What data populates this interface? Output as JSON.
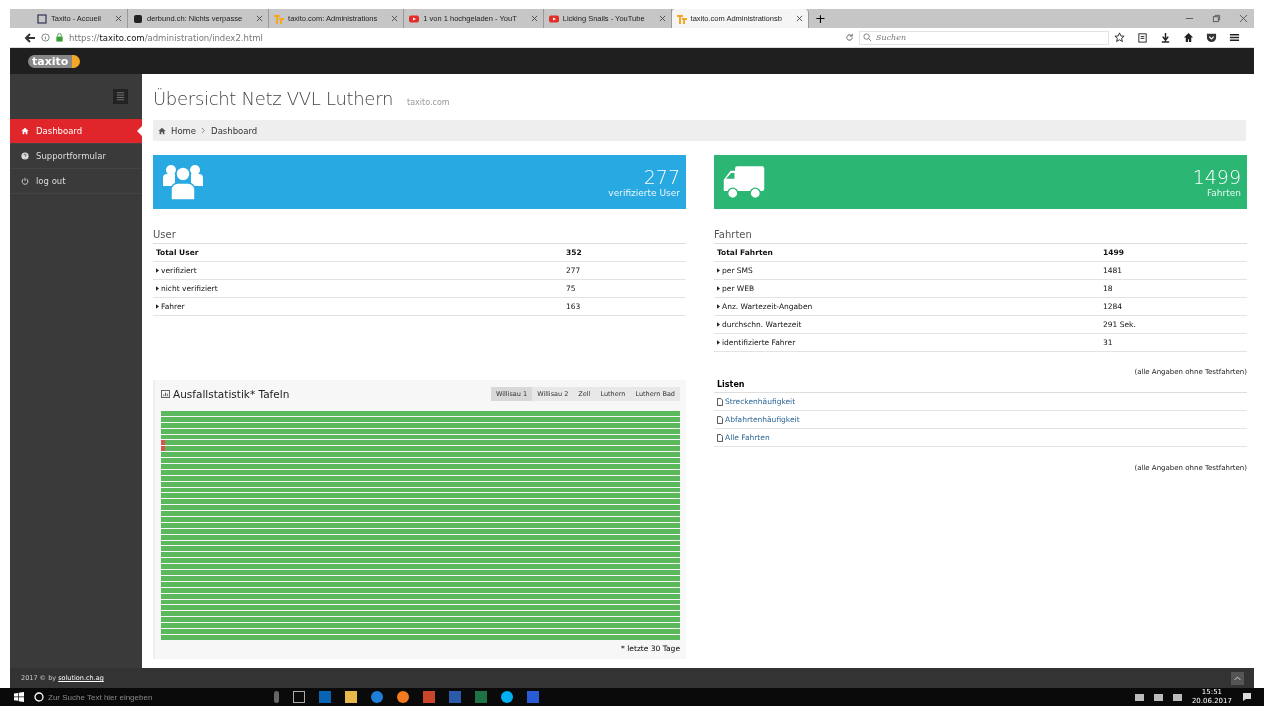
{
  "browser": {
    "tabs": [
      {
        "title": "Taxito - Accueil",
        "selected": false
      },
      {
        "title": "derbund.ch: Nichts verpasse",
        "selected": false
      },
      {
        "title": "taxito.com: Administrations",
        "selected": false
      },
      {
        "title": "1 von 1 hochgeladen - YouT",
        "selected": false
      },
      {
        "title": "Licking Snails - YouTube",
        "selected": false
      },
      {
        "title": "taxito.com Administrationsb",
        "selected": true
      }
    ],
    "new_tab": "+",
    "url_scheme": "https://",
    "url_host": "taxito.com",
    "url_path": "/administration/index2.html",
    "search_placeholder": "Suchen"
  },
  "header": {
    "logo": "taxito"
  },
  "sidebar": {
    "items": [
      {
        "label": "Dashboard",
        "selected": true
      },
      {
        "label": "Supportformular",
        "selected": false
      },
      {
        "label": "log out",
        "selected": false
      }
    ]
  },
  "page": {
    "title": "Übersicht Netz VVL Luthern",
    "subtitle": "taxito.com",
    "breadcrumb": [
      "Home",
      "Dashboard"
    ]
  },
  "info_boxes": [
    {
      "kind": "users",
      "value": "277",
      "label": "verifizierte User",
      "color": "#29a9e1"
    },
    {
      "kind": "truck",
      "value": "1499",
      "label": "Fahrten",
      "color": "#2bb673"
    }
  ],
  "user_table": {
    "title": "User",
    "rows": [
      {
        "label": "Total User",
        "value": "352",
        "total": true
      },
      {
        "label": "verifiziert",
        "value": "277",
        "total": false
      },
      {
        "label": "nicht verifiziert",
        "value": "75",
        "total": false
      },
      {
        "label": "Fahrer",
        "value": "163",
        "total": false
      }
    ]
  },
  "rides_table": {
    "title": "Fahrten",
    "rows": [
      {
        "label": "Total Fahrten",
        "value": "1499",
        "total": true
      },
      {
        "label": "per SMS",
        "value": "1481",
        "total": false
      },
      {
        "label": "per WEB",
        "value": "18",
        "total": false
      },
      {
        "label": "Anz. Wartezeit-Angaben",
        "value": "1284",
        "total": false
      },
      {
        "label": "durchschn. Wartezeit",
        "value": "291 Sek.",
        "total": false
      },
      {
        "label": "identifizierte Fahrer",
        "value": "31",
        "total": false
      }
    ],
    "note": "(alle Angaben ohne Testfahrten)"
  },
  "lists": {
    "title": "Listen",
    "links": [
      "Streckenhäufigkeit",
      "Abfahrtenhäufigkeit",
      "Alle Fahrten"
    ],
    "note": "(alle Angaben ohne Testfahrten)"
  },
  "failure_panel": {
    "title": "Ausfallstatistik* Tafeln",
    "tabs": [
      {
        "label": "Willisau 1",
        "selected": true
      },
      {
        "label": "Willisau 2",
        "selected": false
      },
      {
        "label": "Zell",
        "selected": false
      },
      {
        "label": "Luthern",
        "selected": false
      },
      {
        "label": "Luthern Bad",
        "selected": false
      }
    ],
    "rows": [
      {
        "failure": false
      },
      {
        "failure": false
      },
      {
        "failure": false
      },
      {
        "failure": false
      },
      {
        "failure": false
      },
      {
        "failure": true
      },
      {
        "failure": true
      },
      {
        "failure": false
      },
      {
        "failure": false
      },
      {
        "failure": false
      },
      {
        "failure": false
      },
      {
        "failure": false
      },
      {
        "failure": false
      },
      {
        "failure": false
      },
      {
        "failure": false
      },
      {
        "failure": false
      },
      {
        "failure": false
      },
      {
        "failure": false
      },
      {
        "failure": false
      },
      {
        "failure": false
      },
      {
        "failure": false
      },
      {
        "failure": false
      },
      {
        "failure": false
      },
      {
        "failure": false
      },
      {
        "failure": false
      },
      {
        "failure": false
      },
      {
        "failure": false
      },
      {
        "failure": false
      },
      {
        "failure": false
      },
      {
        "failure": false
      },
      {
        "failure": false
      },
      {
        "failure": false
      },
      {
        "failure": false
      },
      {
        "failure": false
      },
      {
        "failure": false
      },
      {
        "failure": false
      },
      {
        "failure": false
      },
      {
        "failure": false
      },
      {
        "failure": false
      }
    ],
    "footnote": "* letzte 30 Tage"
  },
  "footer": {
    "prefix": "2017 © by",
    "link": "solution.ch.ag"
  },
  "taskbar": {
    "search_placeholder": "Zur Suche Text hier eingeben",
    "time": "15:51",
    "date": "20.06.2017"
  }
}
